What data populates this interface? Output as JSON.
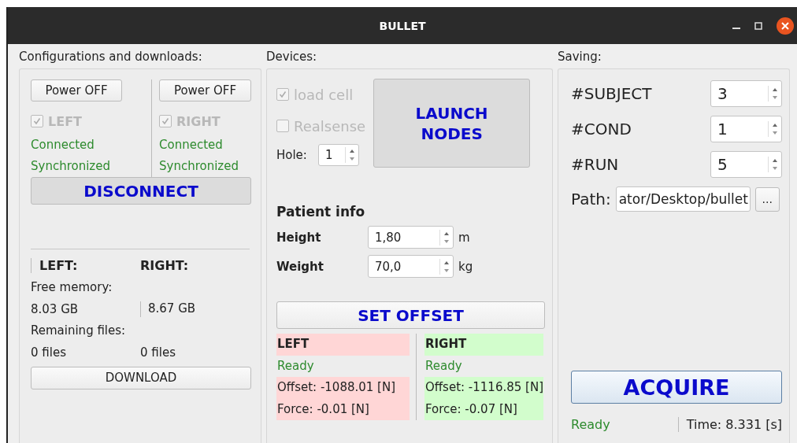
{
  "window": {
    "title": "BULLET"
  },
  "config": {
    "title": "Configurations and downloads:",
    "sides": [
      {
        "power_button": "Power OFF",
        "checkbox": {
          "label": "LEFT",
          "checked": true,
          "disabled": true
        },
        "status": [
          "Connected",
          "Synchronized"
        ]
      },
      {
        "power_button": "Power OFF",
        "checkbox": {
          "label": "RIGHT",
          "checked": true,
          "disabled": true
        },
        "status": [
          "Connected",
          "Synchronized"
        ]
      }
    ],
    "disconnect_button": "DISCONNECT",
    "memory": {
      "headers": [
        "LEFT:",
        "RIGHT:"
      ],
      "free_label": "Free memory:",
      "free": [
        "8.03 GB",
        "8.67 GB"
      ],
      "files_label": "Remaining files:",
      "files": [
        "0 files",
        "0 files"
      ]
    },
    "download_button": "DOWNLOAD"
  },
  "devices": {
    "title": "Devices:",
    "checkboxes": [
      {
        "label": "load cell",
        "checked": true,
        "disabled": true
      },
      {
        "label": "Realsense",
        "checked": false,
        "disabled": true
      }
    ],
    "hole": {
      "label": "Hole:",
      "value": "1"
    },
    "launch_button": "LAUNCH NODES",
    "patient": {
      "title": "Patient info",
      "fields": [
        {
          "label": "Height",
          "value": "1,80",
          "unit": "m"
        },
        {
          "label": "Weight",
          "value": "70,0",
          "unit": "kg"
        }
      ]
    },
    "offset_button": "SET OFFSET",
    "sensors": [
      {
        "name": "LEFT",
        "status": "Ready",
        "offset": "Offset: -1088.01 [N]",
        "force": "Force: -0.01 [N]",
        "color": "#ffd6d6"
      },
      {
        "name": "RIGHT",
        "status": "Ready",
        "offset": "Offset: -1116.85 [N]",
        "force": "Force: -0.07 [N]",
        "color": "#d2fdcc"
      }
    ]
  },
  "saving": {
    "title": "Saving:",
    "fields": [
      {
        "label": "#SUBJECT",
        "value": "3"
      },
      {
        "label": "#COND",
        "value": "1"
      },
      {
        "label": "#RUN",
        "value": "5"
      }
    ],
    "path": {
      "label": "Path:",
      "value": "ator/Desktop/bullet",
      "browse_button": "..."
    },
    "acquire_button": "ACQUIRE",
    "status": "Ready",
    "time": "Time: 8.331 [s]"
  }
}
